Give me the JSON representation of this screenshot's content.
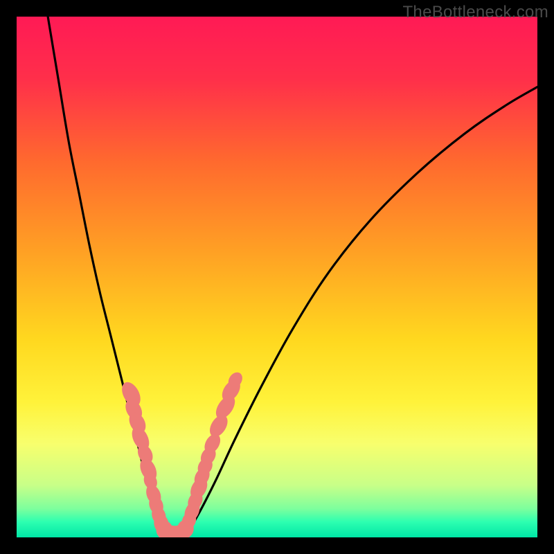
{
  "watermark": "TheBottleneck.com",
  "chart_data": {
    "type": "line",
    "title": "",
    "xlabel": "",
    "ylabel": "",
    "xlim": [
      0,
      100
    ],
    "ylim": [
      0,
      100
    ],
    "gradient_stops": [
      {
        "offset": 0.0,
        "color": "#ff1a55"
      },
      {
        "offset": 0.12,
        "color": "#ff2f4a"
      },
      {
        "offset": 0.28,
        "color": "#ff6a2e"
      },
      {
        "offset": 0.45,
        "color": "#ffa024"
      },
      {
        "offset": 0.62,
        "color": "#ffd81f"
      },
      {
        "offset": 0.74,
        "color": "#fff23a"
      },
      {
        "offset": 0.82,
        "color": "#f8ff6d"
      },
      {
        "offset": 0.9,
        "color": "#c8ff88"
      },
      {
        "offset": 0.945,
        "color": "#7dff9d"
      },
      {
        "offset": 0.97,
        "color": "#2dffb0"
      },
      {
        "offset": 1.0,
        "color": "#00e6a6"
      }
    ],
    "series": [
      {
        "name": "left-curve",
        "x": [
          6,
          8,
          10,
          12,
          14,
          16,
          18,
          20,
          21.5,
          23,
          24.2,
          25.2,
          26.0,
          26.7,
          27.2,
          27.6,
          27.9,
          28.1,
          28.3
        ],
        "y": [
          100,
          88,
          76,
          66,
          56,
          47,
          39,
          31,
          25,
          19,
          14,
          10,
          7,
          5,
          3.4,
          2.2,
          1.2,
          0.5,
          0.0
        ]
      },
      {
        "name": "valley-floor",
        "x": [
          28.3,
          29.0,
          29.8,
          30.6,
          31.4,
          32.2
        ],
        "y": [
          0.0,
          0.0,
          0.0,
          0.0,
          0.0,
          0.0
        ]
      },
      {
        "name": "right-curve",
        "x": [
          32.2,
          33.0,
          34.2,
          36.0,
          38.5,
          42,
          47,
          53,
          60,
          68,
          77,
          86,
          94,
          100
        ],
        "y": [
          0.0,
          1.2,
          3.2,
          6.5,
          11.5,
          19,
          29,
          40,
          51,
          61,
          70,
          77.5,
          83,
          86.5
        ]
      }
    ],
    "scatter_overlay": {
      "name": "salmon-dots",
      "color": "#ed7b78",
      "points": [
        {
          "x": 22.0,
          "y": 27.5,
          "rx": 1.5,
          "ry": 2.5,
          "rot": -28
        },
        {
          "x": 22.5,
          "y": 24.5,
          "rx": 1.4,
          "ry": 2.1,
          "rot": -28
        },
        {
          "x": 23.2,
          "y": 22.0,
          "rx": 1.4,
          "ry": 2.1,
          "rot": -28
        },
        {
          "x": 23.8,
          "y": 19.0,
          "rx": 1.4,
          "ry": 2.4,
          "rot": -26
        },
        {
          "x": 24.7,
          "y": 16.0,
          "rx": 1.3,
          "ry": 1.9,
          "rot": -26
        },
        {
          "x": 25.3,
          "y": 13.0,
          "rx": 1.4,
          "ry": 2.3,
          "rot": -24
        },
        {
          "x": 25.7,
          "y": 10.8,
          "rx": 1.2,
          "ry": 1.6,
          "rot": -24
        },
        {
          "x": 26.3,
          "y": 8.2,
          "rx": 1.3,
          "ry": 2.0,
          "rot": -22
        },
        {
          "x": 26.8,
          "y": 6.2,
          "rx": 1.3,
          "ry": 1.8,
          "rot": -20
        },
        {
          "x": 27.3,
          "y": 4.2,
          "rx": 1.3,
          "ry": 1.8,
          "rot": -18
        },
        {
          "x": 27.8,
          "y": 2.6,
          "rx": 1.4,
          "ry": 1.9,
          "rot": -14
        },
        {
          "x": 28.4,
          "y": 1.4,
          "rx": 1.6,
          "ry": 1.8,
          "rot": -6
        },
        {
          "x": 29.6,
          "y": 0.9,
          "rx": 2.3,
          "ry": 1.4,
          "rot": 0
        },
        {
          "x": 31.2,
          "y": 0.9,
          "rx": 2.0,
          "ry": 1.4,
          "rot": 0
        },
        {
          "x": 32.4,
          "y": 1.6,
          "rx": 1.6,
          "ry": 1.8,
          "rot": 14
        },
        {
          "x": 33.1,
          "y": 3.2,
          "rx": 1.3,
          "ry": 1.7,
          "rot": 22
        },
        {
          "x": 33.7,
          "y": 5.0,
          "rx": 1.3,
          "ry": 2.1,
          "rot": 24
        },
        {
          "x": 34.3,
          "y": 7.0,
          "rx": 1.3,
          "ry": 1.8,
          "rot": 26
        },
        {
          "x": 35.0,
          "y": 9.4,
          "rx": 1.4,
          "ry": 2.2,
          "rot": 28
        },
        {
          "x": 35.6,
          "y": 11.6,
          "rx": 1.3,
          "ry": 1.9,
          "rot": 28
        },
        {
          "x": 36.2,
          "y": 13.6,
          "rx": 1.3,
          "ry": 1.7,
          "rot": 30
        },
        {
          "x": 36.8,
          "y": 15.6,
          "rx": 1.3,
          "ry": 1.8,
          "rot": 30
        },
        {
          "x": 37.6,
          "y": 18.0,
          "rx": 1.3,
          "ry": 2.0,
          "rot": 30
        },
        {
          "x": 38.8,
          "y": 21.4,
          "rx": 1.4,
          "ry": 2.3,
          "rot": 32
        },
        {
          "x": 40.1,
          "y": 25.0,
          "rx": 1.4,
          "ry": 2.5,
          "rot": 34
        },
        {
          "x": 41.2,
          "y": 28.2,
          "rx": 1.4,
          "ry": 2.3,
          "rot": 34
        },
        {
          "x": 42.0,
          "y": 30.2,
          "rx": 1.2,
          "ry": 1.6,
          "rot": 34
        }
      ]
    }
  }
}
